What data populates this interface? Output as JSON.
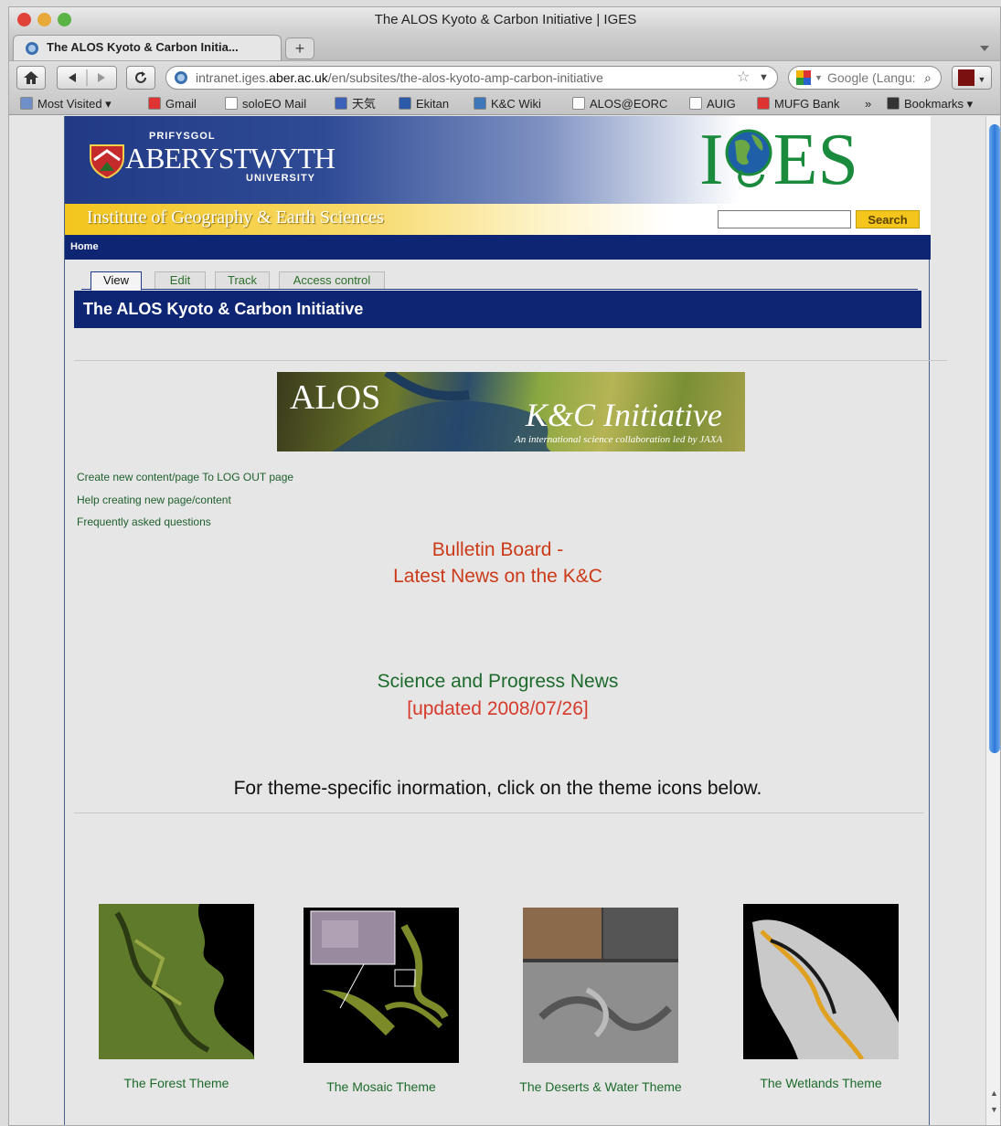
{
  "window": {
    "title": "The ALOS Kyoto & Carbon Initiative | IGES"
  },
  "tab": {
    "label": "The ALOS Kyoto & Carbon Initia...",
    "new_tab": "+"
  },
  "nav": {
    "url_host_prefix": "intranet.iges.",
    "url_host_bold": "aber.ac.uk",
    "url_path": "/en/subsites/the-alos-kyoto-amp-carbon-initiative",
    "search_placeholder": "Google (Langu:"
  },
  "bookmarks": [
    {
      "label": "Most Visited ▾",
      "icon_color": "#6f8fc9"
    },
    {
      "label": "Gmail",
      "icon_color": "#d33"
    },
    {
      "label": "soloEO Mail",
      "icon_color": "#fff"
    },
    {
      "label": "天気",
      "icon_color": "#3b62b8"
    },
    {
      "label": "Ekitan",
      "icon_color": "#2d5aa8"
    },
    {
      "label": "K&C Wiki",
      "icon_color": "#3f78b8"
    },
    {
      "label": "ALOS@EORC",
      "icon_color": "#fff"
    },
    {
      "label": "AUIG",
      "icon_color": "#fff"
    },
    {
      "label": "MUFG Bank",
      "icon_color": "#d33"
    },
    {
      "label": "»",
      "icon_color": ""
    },
    {
      "label": "Bookmarks ▾",
      "icon_color": "#333"
    }
  ],
  "header": {
    "uni_small": "PRIFYSGOL",
    "uni_name": "ABERYSTWYTH",
    "uni_sub": "UNIVERSITY",
    "brand_left": "I",
    "brand_right": "ES",
    "brand_color": "#1a8a3c",
    "institute": "Institute of Geography & Earth Sciences",
    "search_button": "Search",
    "breadcrumb": "Home"
  },
  "page_tabs": [
    "View",
    "Edit",
    "Track",
    "Access control"
  ],
  "page_title": "The ALOS Kyoto & Carbon Initiative",
  "hero": {
    "alos": "ALOS",
    "kc": "K&C Initiative",
    "tagline": "An international science collaboration led by JAXA"
  },
  "links": [
    "Create new content/page To LOG OUT page",
    "Help creating new page/content",
    "Frequently asked questions"
  ],
  "bulletin": {
    "line1": "Bulletin Board -",
    "line2": "Latest News on the K&C",
    "color": "#cc3a17"
  },
  "science": {
    "line1": "Science and Progress News",
    "line2": "[updated 2008/07/26]",
    "color1": "#1d6b2c",
    "color2": "#d63a2a"
  },
  "instruction": "For theme-specific inormation, click on the theme icons below.",
  "themes": [
    "The Forest Theme",
    "The Mosaic Theme",
    "The Deserts & Water Theme",
    "The Wetlands Theme"
  ]
}
